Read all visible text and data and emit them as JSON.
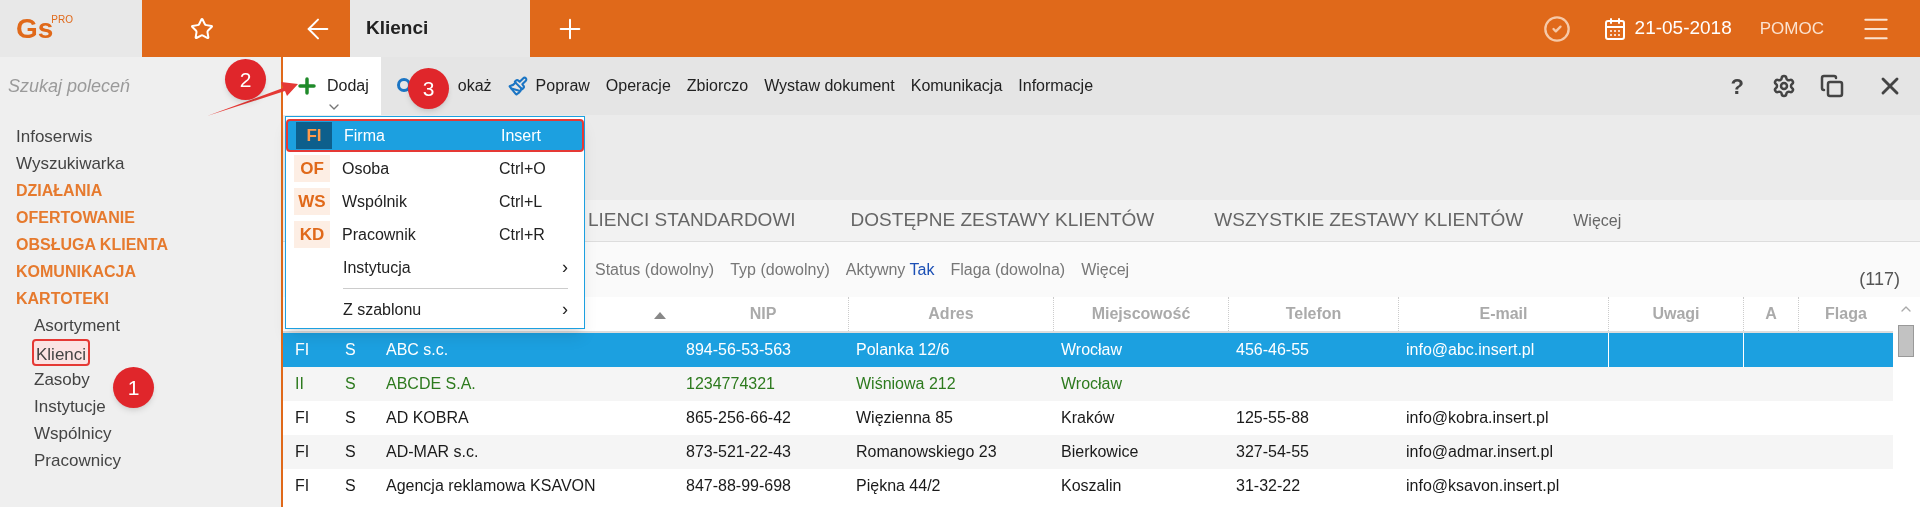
{
  "topbar": {
    "logo": "Gs",
    "logo_badge": "PRO",
    "tab": "Klienci",
    "date": "21-05-2018",
    "help": "POMOC"
  },
  "sidebar": {
    "search": {
      "placeholder": "Szukaj poleceń"
    },
    "items": [
      {
        "label": "Infoserwis",
        "kind": "link"
      },
      {
        "label": "Wyszukiwarka",
        "kind": "link"
      },
      {
        "label": "DZIAŁANIA",
        "kind": "section"
      },
      {
        "label": "OFERTOWANIE",
        "kind": "section"
      },
      {
        "label": "OBSŁUGA KLIENTA",
        "kind": "section"
      },
      {
        "label": "KOMUNIKACJA",
        "kind": "section"
      },
      {
        "label": "KARTOTEKI",
        "kind": "section",
        "children": [
          {
            "label": "Asortyment",
            "highlighted": false
          },
          {
            "label": "Klienci",
            "highlighted": true
          },
          {
            "label": "Zasoby",
            "highlighted": false
          },
          {
            "label": "Instytucje",
            "highlighted": false
          },
          {
            "label": "Wspólnicy",
            "highlighted": false
          },
          {
            "label": "Pracownicy",
            "highlighted": false
          }
        ]
      }
    ]
  },
  "toolbar": {
    "items": [
      {
        "label": "Dodaj",
        "kind": "plus",
        "open": true
      },
      {
        "label": "okaż",
        "kind": "search",
        "open": false
      },
      {
        "label": "Popraw",
        "kind": "brush",
        "open": false
      },
      {
        "label": "Operacje",
        "kind": "text",
        "open": false
      },
      {
        "label": "Zbiorczo",
        "kind": "text",
        "open": false
      },
      {
        "label": "Wystaw dokument",
        "kind": "text",
        "open": false
      },
      {
        "label": "Komunikacja",
        "kind": "text",
        "open": false
      },
      {
        "label": "Informacje",
        "kind": "text",
        "open": false
      }
    ],
    "help": "?"
  },
  "menu": {
    "items": [
      {
        "kind": "item",
        "badge": "FI",
        "label": "Firma",
        "shortcut": "Insert",
        "selected": true
      },
      {
        "kind": "item",
        "badge": "OF",
        "label": "Osoba",
        "shortcut": "Ctrl+O",
        "selected": false
      },
      {
        "kind": "item",
        "badge": "WS",
        "label": "Wspólnik",
        "shortcut": "Ctrl+L",
        "selected": false
      },
      {
        "kind": "item",
        "badge": "KD",
        "label": "Pracownik",
        "shortcut": "Ctrl+R",
        "selected": false
      },
      {
        "kind": "submenu",
        "label": "Instytucja",
        "arrow": "›",
        "selected": false
      },
      {
        "kind": "separator"
      },
      {
        "kind": "submenu",
        "label": "Z szablonu",
        "arrow": "›",
        "selected": false
      }
    ]
  },
  "tabs": [
    {
      "label": "LIENCI STANDARDOWI",
      "selected": false
    },
    {
      "label": "DOSTĘPNE ZESTAWY KLIENTÓW",
      "selected": false
    },
    {
      "label": "WSZYSTKIE ZESTAWY KLIENTÓW",
      "selected": false
    },
    {
      "label": "Więcej",
      "selected": false
    }
  ],
  "filters": [
    {
      "label": "Status (dowolny)"
    },
    {
      "label": "Typ (dowolny)"
    },
    {
      "label": "Aktywny",
      "value": "Tak"
    },
    {
      "label": "Flaga (dowolna)"
    },
    {
      "label": "Więcej"
    }
  ],
  "count": "(117)",
  "table": {
    "columns": [
      "",
      "",
      "",
      "NIP",
      "Adres",
      "Miejscowość",
      "Telefon",
      "E-mail",
      "Uwagi",
      "A",
      "Flaga"
    ],
    "rows": [
      {
        "cells": [
          "FI",
          "S",
          "ABC s.c.",
          "894-56-53-563",
          "Polanka  12/6",
          "Wrocław",
          "456-46-55",
          "info@abc.insert.pl",
          "",
          "",
          ""
        ],
        "selected": true,
        "color": "#ffffff"
      },
      {
        "cells": [
          "II",
          "S",
          "ABCDE S.A.",
          "1234774321",
          "Wiśniowa 212",
          "Wrocław",
          "",
          "",
          "",
          "",
          ""
        ],
        "selected": false,
        "color": "#2d7a1e"
      },
      {
        "cells": [
          "FI",
          "S",
          "AD KOBRA",
          "865-256-66-42",
          "Więzienna  85",
          "Kraków",
          "125-55-88",
          "info@kobra.insert.pl",
          "",
          "",
          ""
        ],
        "selected": false,
        "color": "#1a1a1a"
      },
      {
        "cells": [
          "FI",
          "S",
          "AD-MAR s.c.",
          "873-521-22-43",
          "Romanowskiego 23",
          "Bierkowice",
          "327-54-55",
          "info@admar.insert.pl",
          "",
          "",
          ""
        ],
        "selected": false,
        "color": "#1a1a1a"
      },
      {
        "cells": [
          "FI",
          "S",
          "Agencja reklamowa KSAVON",
          "847-88-99-698",
          "Piękna  44/2",
          "Koszalin",
          "31-32-22",
          "info@ksavon.insert.pl",
          "",
          "",
          ""
        ],
        "selected": false,
        "color": "#1a1a1a"
      }
    ]
  },
  "annotations": [
    {
      "label": "1"
    },
    {
      "label": "2"
    },
    {
      "label": "3"
    }
  ]
}
